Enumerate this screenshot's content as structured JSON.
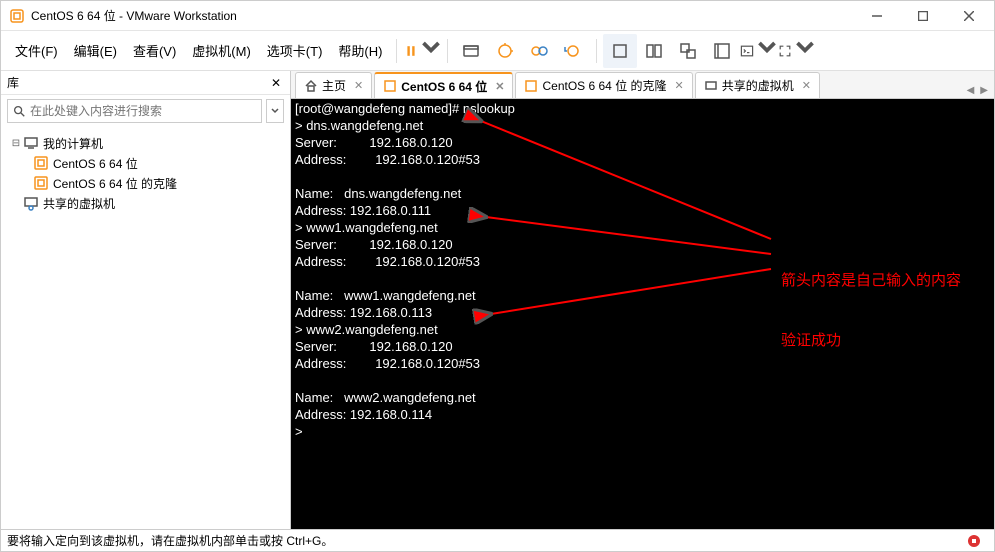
{
  "window": {
    "title": "CentOS 6 64 位 - VMware Workstation"
  },
  "menubar": {
    "file": "文件(F)",
    "edit": "编辑(E)",
    "view": "查看(V)",
    "vm": "虚拟机(M)",
    "tabs": "选项卡(T)",
    "help": "帮助(H)"
  },
  "sidebar": {
    "title": "库",
    "search_placeholder": "在此处键入内容进行搜索",
    "tree": {
      "my_computer": "我的计算机",
      "vm1": "CentOS 6 64 位",
      "vm2": "CentOS 6 64 位 的克隆",
      "shared": "共享的虚拟机"
    }
  },
  "tabs": {
    "home": "主页",
    "vm1": "CentOS 6 64 位",
    "vm2": "CentOS 6 64 位 的克隆",
    "shared": "共享的虚拟机"
  },
  "terminal": {
    "lines": [
      "[root@wangdefeng named]# nslookup",
      "> dns.wangdefeng.net",
      "Server:         192.168.0.120",
      "Address:        192.168.0.120#53",
      "",
      "Name:   dns.wangdefeng.net",
      "Address: 192.168.0.111",
      "> www1.wangdefeng.net",
      "Server:         192.168.0.120",
      "Address:        192.168.0.120#53",
      "",
      "Name:   www1.wangdefeng.net",
      "Address: 192.168.0.113",
      "> www2.wangdefeng.net",
      "Server:         192.168.0.120",
      "Address:        192.168.0.120#53",
      "",
      "Name:   www2.wangdefeng.net",
      "Address: 192.168.0.114",
      "> "
    ]
  },
  "annotation": {
    "line1": "箭头内容是自己输入的内容",
    "line2": "验证成功"
  },
  "statusbar": {
    "text": "要将输入定向到该虚拟机，请在虚拟机内部单击或按 Ctrl+G。"
  }
}
